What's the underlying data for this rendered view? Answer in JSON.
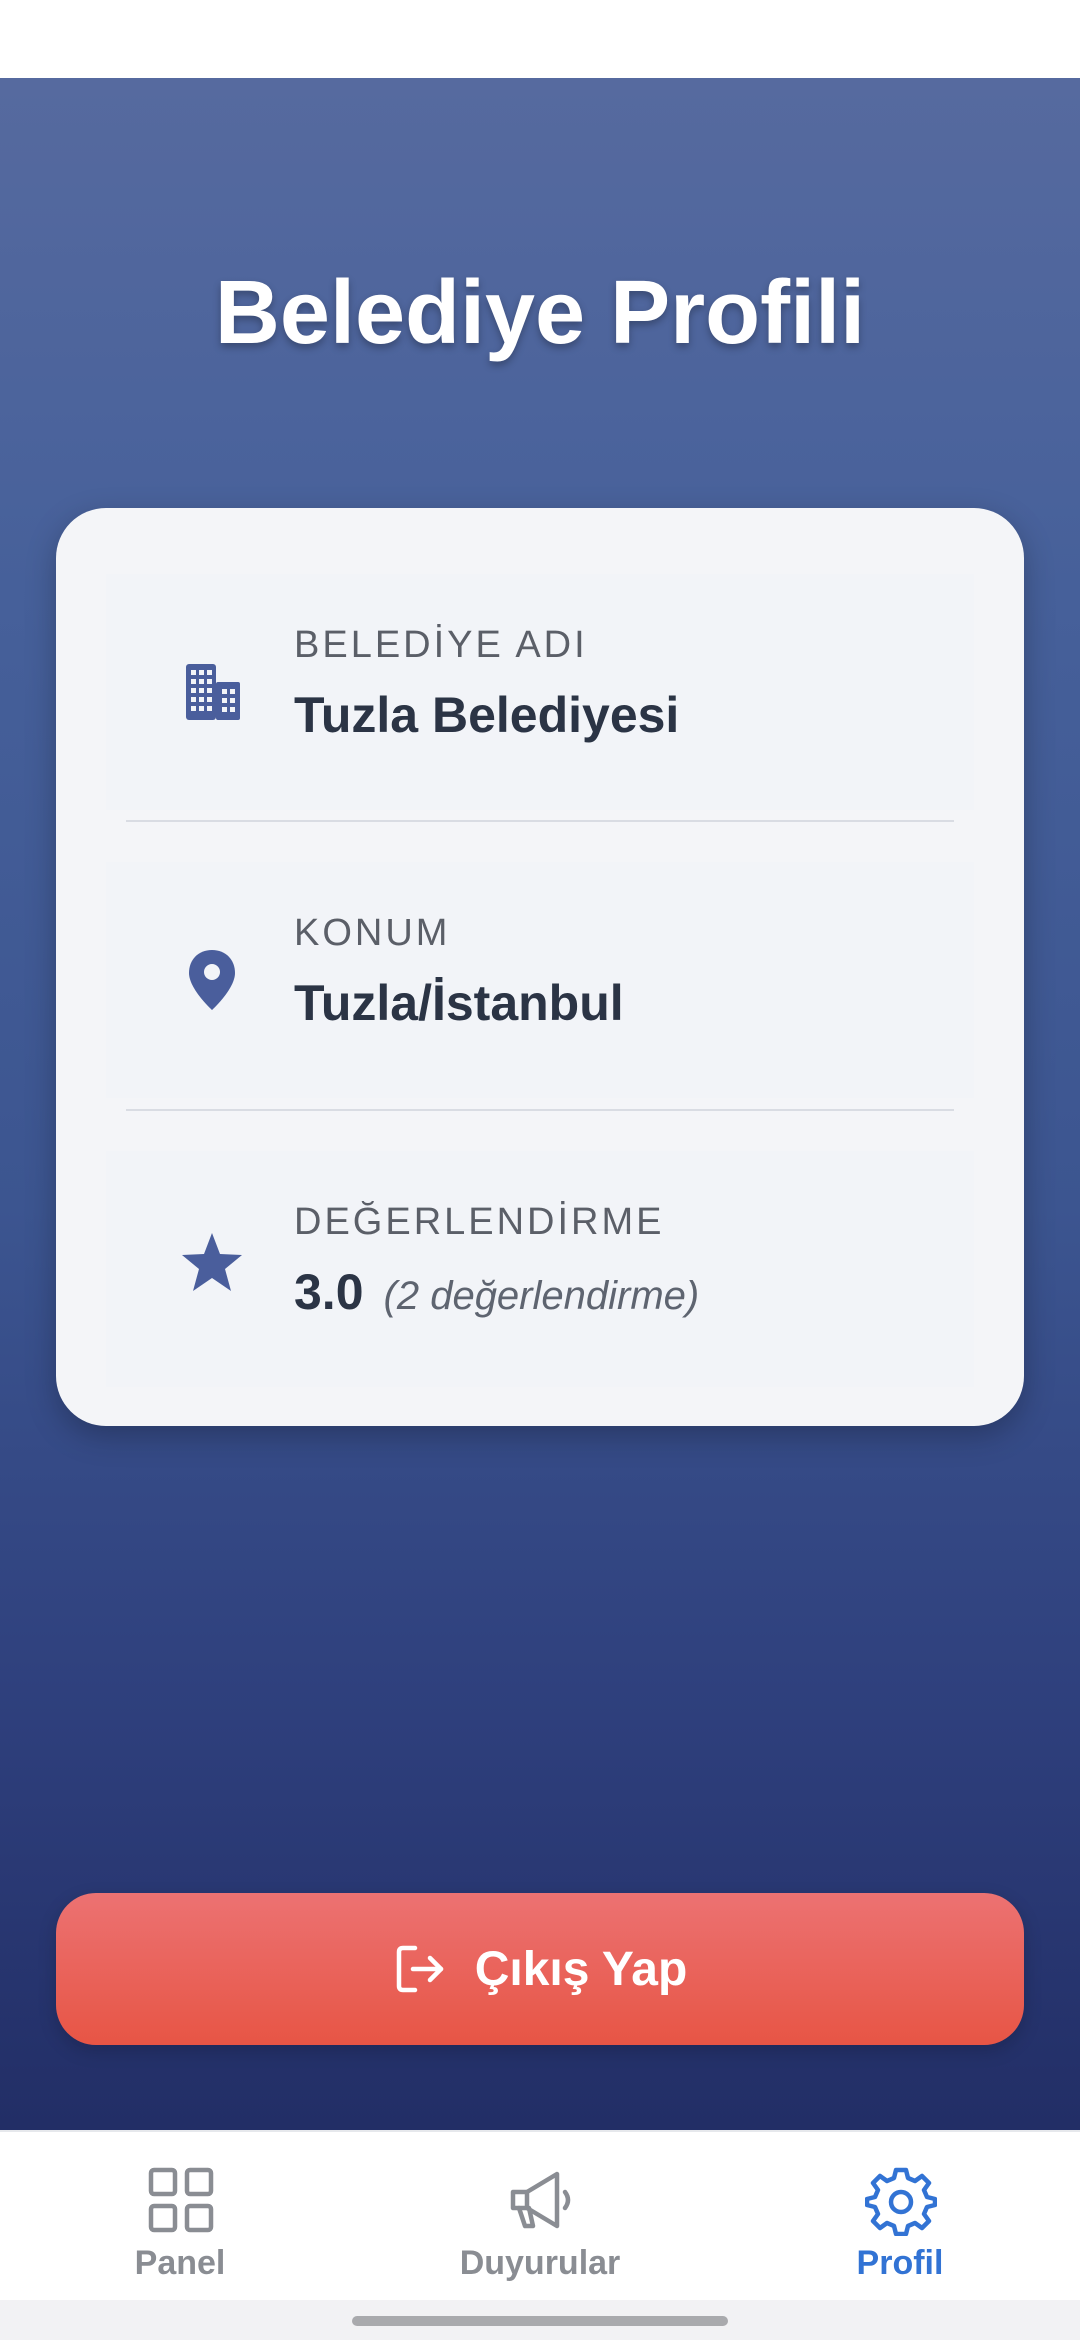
{
  "page": {
    "title": "Belediye Profili"
  },
  "profile": {
    "rows": [
      {
        "icon": "building-icon",
        "label": "BELEDİYE ADI",
        "value": "Tuzla Belediyesi"
      },
      {
        "icon": "location-pin-icon",
        "label": "KONUM",
        "value": "Tuzla/İstanbul"
      },
      {
        "icon": "star-icon",
        "label": "DEĞERLENDİRME",
        "value": "3.0",
        "count": "(2 değerlendirme)"
      }
    ]
  },
  "actions": {
    "logout_label": "Çıkış Yap",
    "logout_icon": "logout-icon"
  },
  "nav": {
    "items": [
      {
        "label": "Panel",
        "icon": "grid-icon",
        "active": false
      },
      {
        "label": "Duyurular",
        "icon": "megaphone-icon",
        "active": false
      },
      {
        "label": "Profil",
        "icon": "gear-icon",
        "active": true
      }
    ]
  },
  "colors": {
    "header_gradient_top": "#566a9f",
    "header_gradient_bottom": "#222e66",
    "card_background": "#f4f5f8",
    "icon_color": "#4a5e9c",
    "logout_top": "#ec7272",
    "logout_bottom": "#e75545",
    "nav_active": "#3273d4",
    "nav_inactive": "#8a8d93"
  }
}
